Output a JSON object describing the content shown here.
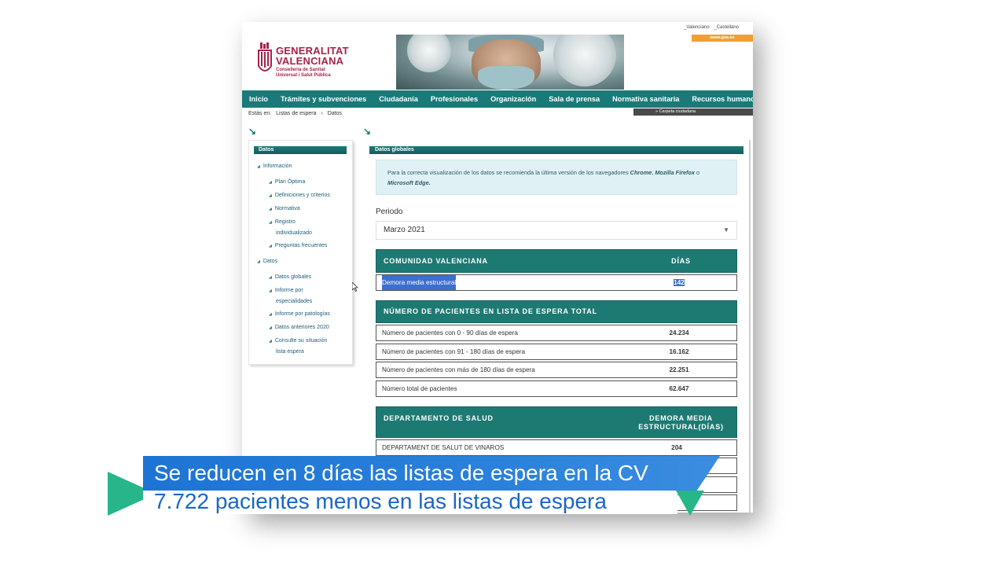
{
  "lang": {
    "valenciano": "_Valenciano",
    "castellano": "_Castellano"
  },
  "gva_tab": "www.gva.es",
  "logo": {
    "line1": "GENERALITAT",
    "line2": "VALENCIANA",
    "sub1": "Conselleria de Sanitat",
    "sub2": "Universal i Salut Pública"
  },
  "nav": [
    "Inicio",
    "Trámites y subvenciones",
    "Ciudadanía",
    "Profesionales",
    "Organización",
    "Sala de prensa",
    "Normativa sanitaria",
    "Recursos humanos"
  ],
  "breadcrumb": {
    "prefix": "Estás en:",
    "item1": "Listas de espera",
    "sep": "›",
    "item2": "Datos"
  },
  "carpeta": "» Carpeta ciudadana",
  "sidebar": {
    "title": "Datos",
    "items": [
      "Información",
      "Plan Óptima",
      "Definiciones y criterios",
      "Normativa",
      "Registro",
      "individualizado",
      "Preguntas frecuentes",
      "Datos",
      "Datos globales",
      "Informe por",
      "especialidades",
      "Informe por patologías",
      "Datos anteriores 2020",
      "Consulte su situación",
      "lista espera"
    ]
  },
  "content": {
    "title": "Datos globales",
    "info": {
      "text1": "Para la correcta visualización de los datos se recomienda la última versión de los navegadores ",
      "b1": "Chrome",
      "sep1": ", ",
      "b2": "Mozilla Firefox",
      "text2": " o",
      "b3": "Microsoft Edge."
    },
    "periodo_label": "Periodo",
    "periodo_value": "Marzo 2021",
    "table1": {
      "col1": "COMUNIDAD VALENCIANA",
      "col2": "DÍAS",
      "row_label": "Demora media estructural",
      "row_value": "142"
    },
    "table2": {
      "header": "NÚMERO DE PACIENTES EN LISTA DE ESPERA TOTAL",
      "rows": [
        {
          "label": "Número de pacientes con 0 - 90 días de espera",
          "value": "24.234"
        },
        {
          "label": "Número de pacientes con 91 - 180 días de espera",
          "value": "16.162"
        },
        {
          "label": "Número de pacientes con más de 180 días de espera",
          "value": "22.251"
        },
        {
          "label": "Número total de pacientes",
          "value": "62.647"
        }
      ]
    },
    "table3": {
      "col1": "DEPARTAMENTO DE SALUD",
      "col2a": "DEMORA MEDIA",
      "col2b": "ESTRUCTURAL(DÍAS)",
      "rows": [
        {
          "label": "DEPARTAMENT DE SALUT DE VINAROS",
          "value": "204"
        }
      ]
    }
  },
  "banner": {
    "line1": "Se reducen en 8 días las listas de espera en la CV",
    "line2": "7.722 pacientes menos en las listas de espera"
  }
}
